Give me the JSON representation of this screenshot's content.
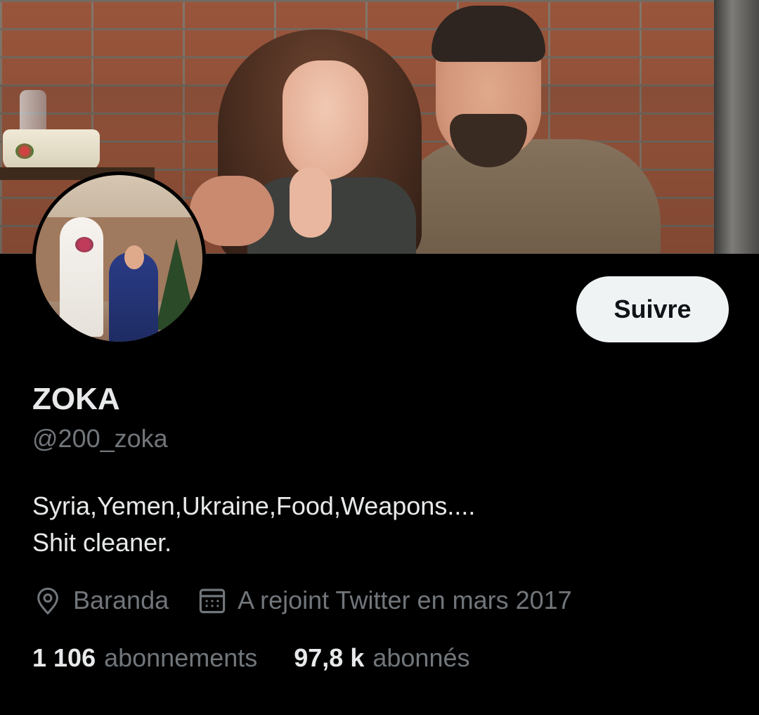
{
  "profile": {
    "display_name": "ZOKA",
    "handle": "@200_zoka",
    "bio_lines": [
      "Syria,Yemen,Ukraine,Food,Weapons....",
      "Shit cleaner."
    ],
    "location": "Baranda",
    "joined": "A rejoint Twitter en mars 2017",
    "follow_label": "Suivre"
  },
  "stats": {
    "following_count": "1 106",
    "following_label": "abonnements",
    "followers_count": "97,8 k",
    "followers_label": "abonnés"
  },
  "icons": {
    "location": "location-pin-icon",
    "joined": "calendar-icon"
  },
  "colors": {
    "background": "#000000",
    "primary_text": "#e7e9ea",
    "secondary_text": "#71767b",
    "button_bg": "#eff3f4",
    "button_text": "#0f1419"
  }
}
